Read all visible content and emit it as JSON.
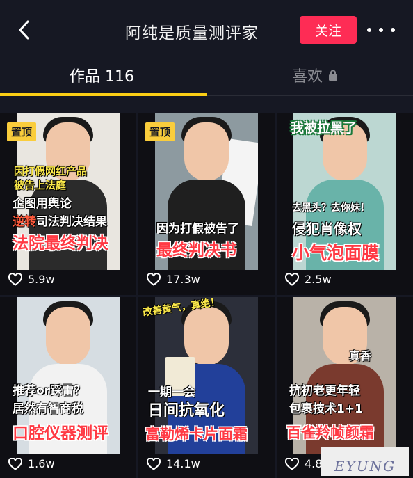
{
  "header": {
    "title": "阿纯是质量测评家",
    "follow_label": "关注"
  },
  "tabs": {
    "works_label": "作品 116",
    "likes_label": "喜欢"
  },
  "pinned_label": "置顶",
  "videos": [
    {
      "likes": "5.9w",
      "pinned": true,
      "captions": {
        "line1": "因打假网红产品",
        "line2": "被告上法庭",
        "line3": "企图用舆论",
        "line4_highlight": "逆转",
        "line4_rest": "司法判决结果",
        "line5": "法院最终判决"
      }
    },
    {
      "likes": "17.3w",
      "pinned": true,
      "captions": {
        "line1": "因为打假被告了",
        "line2": "最终判决书"
      }
    },
    {
      "likes": "2.5w",
      "pinned": false,
      "captions": {
        "top": "我被拉黑了",
        "line1": "去黑头？去你妹！",
        "line2": "侵犯肖像权",
        "line3": "小气泡面膜"
      }
    },
    {
      "likes": "1.6w",
      "pinned": false,
      "captions": {
        "line1": "推荐or踩雷？",
        "line2": "居然有智商税",
        "line3": "口腔仪器测评"
      }
    },
    {
      "likes": "14.1w",
      "pinned": false,
      "captions": {
        "top": "改善黄气，真绝！",
        "line1": "一期一会",
        "line2": "日间抗氧化",
        "line3": "富勒烯卡片面霜"
      }
    },
    {
      "likes": "4.8w",
      "pinned": false,
      "captions": {
        "top": "真香",
        "line1": "抗初老更年轻",
        "line2": "包裹技术1+1",
        "line3": "百雀羚帧颜霜"
      }
    }
  ],
  "watermark": "EYUNG",
  "colors": {
    "background": "#161823",
    "follow_button": "#fe2c55",
    "tab_underline": "#face15",
    "pin_badge": "#facd3c",
    "caption_red": "#ff3a44",
    "caption_yellow": "#fbe94a"
  },
  "icons": {
    "back": "chevron-left-icon",
    "more": "more-dots-icon",
    "lock": "lock-icon",
    "like": "heart-outline-icon"
  }
}
